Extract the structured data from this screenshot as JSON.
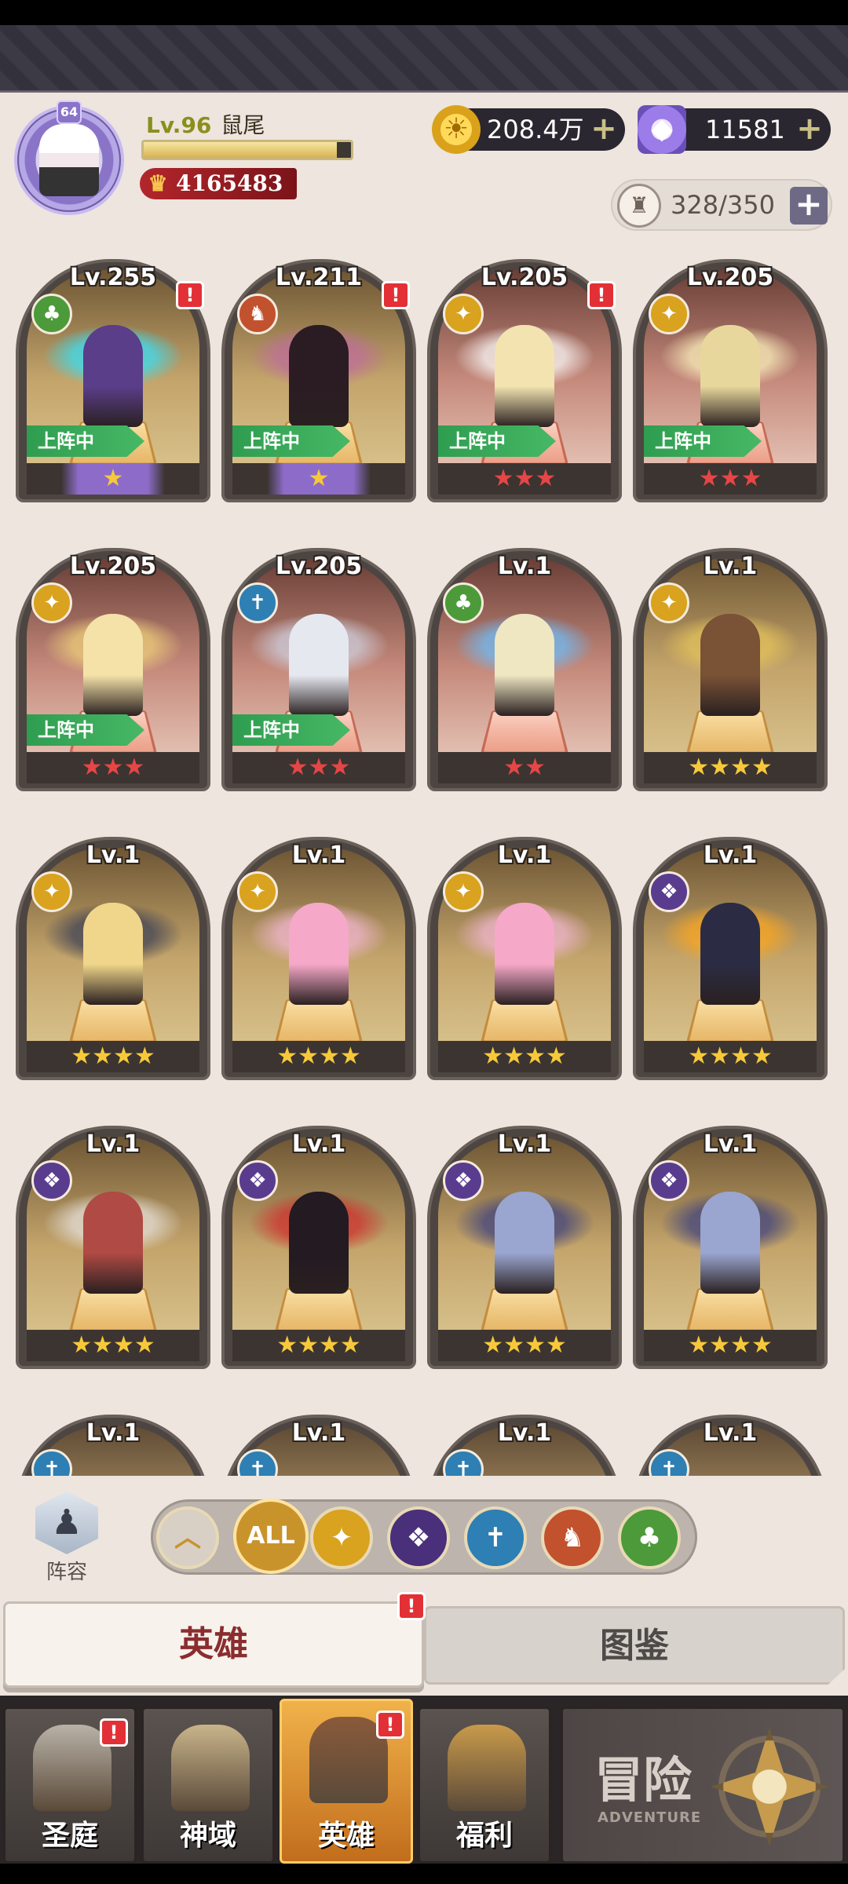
{
  "player": {
    "level": "Lv.96",
    "name": "鼠尾",
    "avatar_badge": "64",
    "xp_fraction": 0.93,
    "power": "4165483"
  },
  "currency": {
    "gold": "208.4万",
    "gems": "11581"
  },
  "capacity": "328/350",
  "heroes": [
    {
      "level": "Lv.255",
      "faction": "nature",
      "alert": true,
      "active": true,
      "stars": "★",
      "star_style": "purple",
      "bg": "gold-bg",
      "color": "#5a3e8a",
      "wing": "#31e4ff"
    },
    {
      "level": "Lv.211",
      "faction": "fox",
      "alert": true,
      "active": true,
      "stars": "★",
      "star_style": "purple",
      "bg": "gold-bg",
      "color": "#2b1c24",
      "wing": "#c06aa0"
    },
    {
      "level": "Lv.205",
      "faction": "light",
      "alert": true,
      "active": true,
      "stars": "★★★",
      "star_style": "red",
      "bg": "red-bg",
      "color": "#f2e3b0",
      "wing": "#ffffff"
    },
    {
      "level": "Lv.205",
      "faction": "light",
      "alert": false,
      "active": true,
      "stars": "★★★",
      "star_style": "red",
      "bg": "red-bg",
      "color": "#e8d79c",
      "wing": "#fff6c0"
    },
    {
      "level": "Lv.205",
      "faction": "light",
      "alert": false,
      "active": true,
      "stars": "★★★",
      "star_style": "red",
      "bg": "red-bg",
      "color": "#f4e2a8",
      "wing": "#f1d37a"
    },
    {
      "level": "Lv.205",
      "faction": "holy",
      "alert": false,
      "active": true,
      "stars": "★★★",
      "star_style": "red",
      "bg": "red-bg",
      "color": "#e6e8f0",
      "wing": "#d0d4e4"
    },
    {
      "level": "Lv.1",
      "faction": "nature",
      "alert": false,
      "active": false,
      "stars": "★★",
      "star_style": "red",
      "bg": "red-bg",
      "color": "#efe6c2",
      "wing": "#6ac0ff"
    },
    {
      "level": "Lv.1",
      "faction": "light",
      "alert": false,
      "active": false,
      "stars": "★★★★",
      "star_style": "gold",
      "bg": "gold-bg",
      "color": "#7a5236",
      "wing": "#e8c65a"
    },
    {
      "level": "Lv.1",
      "faction": "light",
      "alert": false,
      "active": false,
      "stars": "★★★★",
      "star_style": "gold",
      "bg": "gold-bg",
      "color": "#f0d68a",
      "wing": "#3a3f55"
    },
    {
      "level": "Lv.1",
      "faction": "light",
      "alert": false,
      "active": false,
      "stars": "★★★★",
      "star_style": "gold",
      "bg": "gold-bg",
      "color": "#f5a8c8",
      "wing": "#f5b8d8"
    },
    {
      "level": "Lv.1",
      "faction": "light",
      "alert": false,
      "active": false,
      "stars": "★★★★",
      "star_style": "gold",
      "bg": "gold-bg",
      "color": "#f5a8c8",
      "wing": "#f5b8d8"
    },
    {
      "level": "Lv.1",
      "faction": "dark",
      "alert": false,
      "active": false,
      "stars": "★★★★",
      "star_style": "gold",
      "bg": "gold-bg",
      "color": "#2b2c44",
      "wing": "#ffa81e"
    },
    {
      "level": "Lv.1",
      "faction": "dark",
      "alert": false,
      "active": false,
      "stars": "★★★★",
      "star_style": "gold",
      "bg": "gold-bg",
      "color": "#b04a44",
      "wing": "#e8e4e0"
    },
    {
      "level": "Lv.1",
      "faction": "dark",
      "alert": false,
      "active": false,
      "stars": "★★★★",
      "star_style": "gold",
      "bg": "gold-bg",
      "color": "#231a22",
      "wing": "#d02a2a"
    },
    {
      "level": "Lv.1",
      "faction": "dark",
      "alert": false,
      "active": false,
      "stars": "★★★★",
      "star_style": "gold",
      "bg": "gold-bg",
      "color": "#9aa6d0",
      "wing": "#3a3f80"
    },
    {
      "level": "Lv.1",
      "faction": "dark",
      "alert": false,
      "active": false,
      "stars": "★★★★",
      "star_style": "gold",
      "bg": "gold-bg",
      "color": "#9aa6d0",
      "wing": "#3a3f80"
    },
    {
      "level": "Lv.1",
      "faction": "holy",
      "alert": false,
      "active": false,
      "stars": "",
      "star_style": "gold",
      "bg": "tan-bg",
      "color": "#7a6a5a",
      "wing": "#000000"
    },
    {
      "level": "Lv.1",
      "faction": "holy",
      "alert": false,
      "active": false,
      "stars": "",
      "star_style": "gold",
      "bg": "tan-bg",
      "color": "#7a6a5a",
      "wing": "#000000"
    },
    {
      "level": "Lv.1",
      "faction": "holy",
      "alert": false,
      "active": false,
      "stars": "",
      "star_style": "gold",
      "bg": "tan-bg",
      "color": "#7a6a5a",
      "wing": "#000000"
    },
    {
      "level": "Lv.1",
      "faction": "holy",
      "alert": false,
      "active": false,
      "stars": "",
      "star_style": "gold",
      "bg": "tan-bg",
      "color": "#7a6a5a",
      "wing": "#000000"
    }
  ],
  "active_label": "上阵中",
  "lineup_label": "阵容",
  "filters": [
    {
      "name": "collapse",
      "label": "︿",
      "color": "#d8cfc5"
    },
    {
      "name": "all",
      "label": "ALL",
      "color": "#c9932c"
    },
    {
      "name": "light",
      "label": "✦",
      "color": "#d9a21f"
    },
    {
      "name": "dark",
      "label": "❖",
      "color": "#4a2f7a"
    },
    {
      "name": "holy",
      "label": "✝",
      "color": "#2e7fb3"
    },
    {
      "name": "fox",
      "label": "♞",
      "color": "#c2512e"
    },
    {
      "name": "nature",
      "label": "♣",
      "color": "#4c9a3a"
    }
  ],
  "tabs": {
    "heroes": "英雄",
    "codex": "图鉴"
  },
  "nav": [
    {
      "label": "圣庭",
      "alert": true,
      "selected": false,
      "color": "#b9b2a8"
    },
    {
      "label": "神域",
      "alert": false,
      "selected": false,
      "color": "#c9b48a"
    },
    {
      "label": "英雄",
      "alert": true,
      "selected": true,
      "color": "#8a5a3a"
    },
    {
      "label": "福利",
      "alert": false,
      "selected": false,
      "color": "#c99a4a"
    }
  ],
  "adventure": {
    "title": "冒险",
    "subtitle": "ADVENTURE"
  },
  "alert_mark": "!",
  "plus_mark": "+"
}
